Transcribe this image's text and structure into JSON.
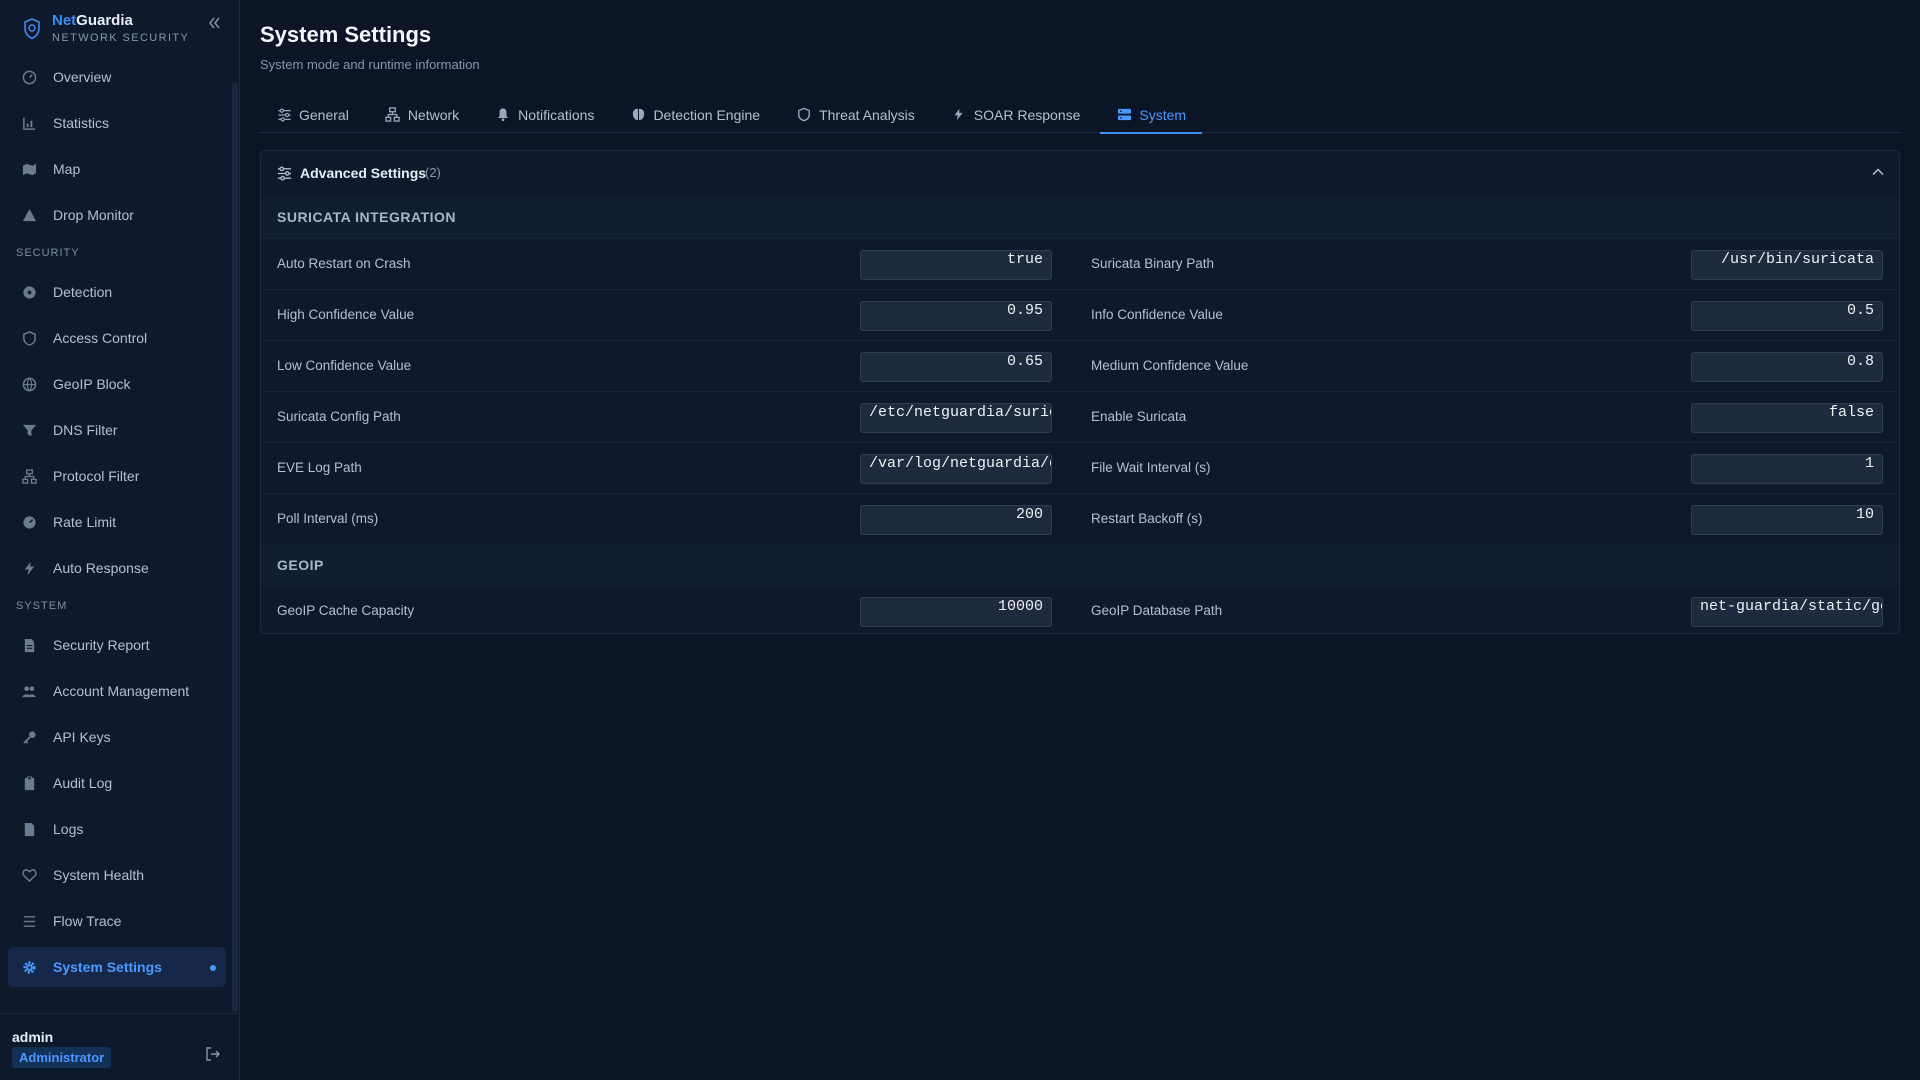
{
  "brand": {
    "name_prefix": "Net",
    "name_suffix": "Guardia",
    "subtitle": "NETWORK SECURITY"
  },
  "nav": {
    "main": [
      {
        "label": "Overview",
        "icon": "gauge-icon"
      },
      {
        "label": "Statistics",
        "icon": "bar-chart-icon"
      },
      {
        "label": "Map",
        "icon": "map-icon"
      },
      {
        "label": "Drop Monitor",
        "icon": "warning-icon"
      }
    ],
    "security_title": "SECURITY",
    "security": [
      {
        "label": "Detection",
        "icon": "radar-icon"
      },
      {
        "label": "Access Control",
        "icon": "shield-icon"
      },
      {
        "label": "GeoIP Block",
        "icon": "globe-icon"
      },
      {
        "label": "DNS Filter",
        "icon": "filter-icon"
      },
      {
        "label": "Protocol Filter",
        "icon": "network-icon"
      },
      {
        "label": "Rate Limit",
        "icon": "speedometer-icon"
      },
      {
        "label": "Auto Response",
        "icon": "lightning-icon"
      }
    ],
    "system_title": "SYSTEM",
    "system": [
      {
        "label": "Security Report",
        "icon": "report-icon"
      },
      {
        "label": "Account Management",
        "icon": "users-icon"
      },
      {
        "label": "API Keys",
        "icon": "key-icon"
      },
      {
        "label": "Audit Log",
        "icon": "clipboard-icon"
      },
      {
        "label": "Logs",
        "icon": "file-icon"
      },
      {
        "label": "System Health",
        "icon": "heart-pulse-icon"
      },
      {
        "label": "Flow Trace",
        "icon": "list-icon"
      },
      {
        "label": "System Settings",
        "icon": "gear-icon",
        "active": true
      }
    ]
  },
  "user": {
    "name": "admin",
    "role": "Administrator"
  },
  "page": {
    "title": "System Settings",
    "subtitle": "System mode and runtime information"
  },
  "tabs": [
    {
      "label": "General",
      "icon": "sliders-icon"
    },
    {
      "label": "Network",
      "icon": "network-icon"
    },
    {
      "label": "Notifications",
      "icon": "bell-icon"
    },
    {
      "label": "Detection Engine",
      "icon": "brain-icon"
    },
    {
      "label": "Threat Analysis",
      "icon": "shield-icon"
    },
    {
      "label": "SOAR Response",
      "icon": "lightning-icon"
    },
    {
      "label": "System",
      "icon": "server-icon",
      "active": true
    }
  ],
  "panel": {
    "title": "Advanced Settings",
    "count": "(2)",
    "sections": [
      {
        "title": "SURICATA INTEGRATION",
        "rows": [
          [
            {
              "label": "Auto Restart on Crash",
              "value": "true"
            },
            {
              "label": "Suricata Binary Path",
              "value": "/usr/bin/suricata"
            }
          ],
          [
            {
              "label": "High Confidence Value",
              "value": "0.95"
            },
            {
              "label": "Info Confidence Value",
              "value": "0.5"
            }
          ],
          [
            {
              "label": "Low Confidence Value",
              "value": "0.65"
            },
            {
              "label": "Medium Confidence Value",
              "value": "0.8"
            }
          ],
          [
            {
              "label": "Suricata Config Path",
              "value": "/etc/netguardia/suricata.yaml"
            },
            {
              "label": "Enable Suricata",
              "value": "false"
            }
          ],
          [
            {
              "label": "EVE Log Path",
              "value": "/var/log/netguardia/eve.json"
            },
            {
              "label": "File Wait Interval (s)",
              "value": "1"
            }
          ],
          [
            {
              "label": "Poll Interval (ms)",
              "value": "200"
            },
            {
              "label": "Restart Backoff (s)",
              "value": "10"
            }
          ]
        ]
      },
      {
        "title": "GEOIP",
        "rows": [
          [
            {
              "label": "GeoIP Cache Capacity",
              "value": "10000"
            },
            {
              "label": "GeoIP Database Path",
              "value": "net-guardia/static/ge"
            }
          ]
        ]
      }
    ]
  },
  "colors": {
    "accent": "#3d8ef0",
    "background": "#0b1525",
    "sidebar": "#0e1a2c"
  }
}
